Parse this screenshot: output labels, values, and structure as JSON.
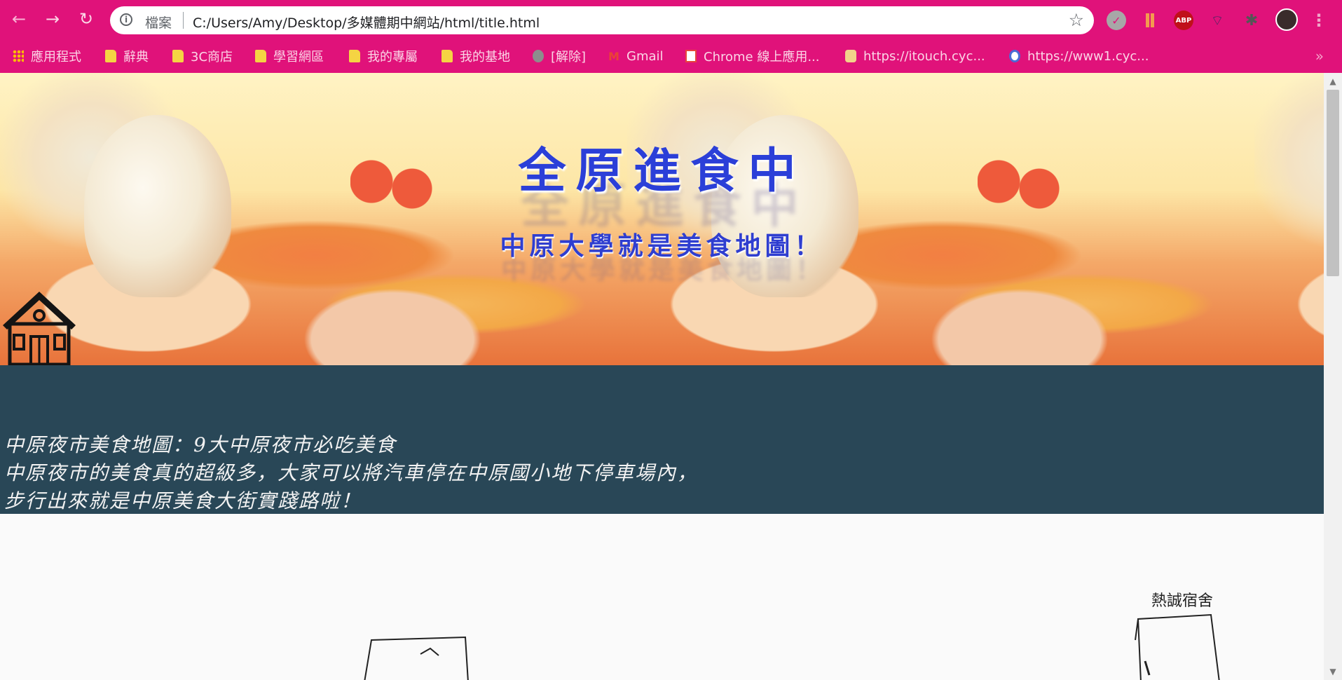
{
  "browser": {
    "back_icon": "←",
    "forward_icon": "→",
    "reload_icon": "↻",
    "address_scheme": "檔案",
    "address_url": "C:/Users/Amy/Desktop/多媒體期中網站/html/title.html",
    "bookmark_star_icon": "☆",
    "abp_label": "ABP",
    "menu_icon": "⋮"
  },
  "bookmarks": [
    {
      "label": "應用程式",
      "icon": "apps-icon"
    },
    {
      "label": "辭典",
      "icon": "folder-icon"
    },
    {
      "label": "3C商店",
      "icon": "folder-icon"
    },
    {
      "label": "學習網區",
      "icon": "folder-icon"
    },
    {
      "label": "我的專屬",
      "icon": "folder-icon"
    },
    {
      "label": "我的基地",
      "icon": "folder-icon"
    },
    {
      "label": "[解除]",
      "icon": "globe-icon"
    },
    {
      "label": "Gmail",
      "icon": "gmail-icon"
    },
    {
      "label": "Chrome 線上應用...",
      "icon": "webstore-icon"
    },
    {
      "label": "https://itouch.cyc...",
      "icon": "site-icon"
    },
    {
      "label": "https://www1.cyc...",
      "icon": "site-icon"
    }
  ],
  "bookmarks_more": "»",
  "banner": {
    "title": "全原進食中",
    "subtitle": "中原大學就是美食地圖！"
  },
  "intro": {
    "line1": "中原夜市美食地圖：9大中原夜市必吃美食",
    "line2": "中原夜市的美食真的超級多，大家可以將汽車停在中原國小地下停車場內，",
    "line3": "步行出來就是中原美食大街實踐路啦！"
  },
  "sketch": {
    "dorm_label": "熱誠宿舍"
  },
  "colors": {
    "chrome_bg": "#e0127a",
    "intro_bg": "#294757",
    "title_color": "#2b3fd8"
  }
}
